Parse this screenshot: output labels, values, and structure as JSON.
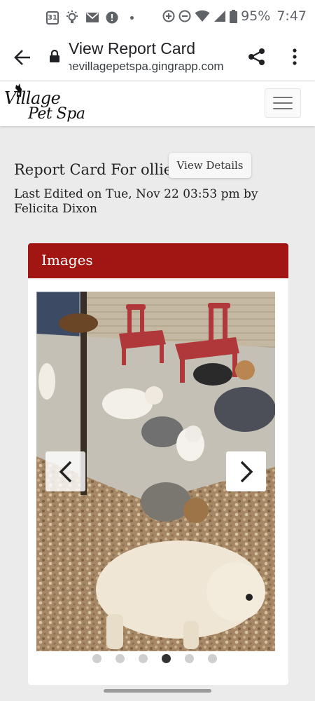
{
  "status_bar": {
    "calendar_day": "31",
    "battery": "95%",
    "time": "7:47",
    "icons": [
      "calendar-icon",
      "lightbulb-icon",
      "mail-icon",
      "alert-icon",
      "dot-icon",
      "data-saver-icon",
      "dnd-icon",
      "wifi-icon",
      "signal-icon",
      "battery-icon"
    ]
  },
  "browser": {
    "title": "View Report Card",
    "url": "thevillagepetspa.gingrapp.com"
  },
  "site": {
    "logo_line1": "Village",
    "logo_line2": "Pet Spa"
  },
  "report": {
    "title": "Report Card For ollie",
    "view_details_label": "View Details",
    "last_edited": "Last Edited on Tue, Nov 22 03:53 pm by Felicita Dixon"
  },
  "images": {
    "header": "Images",
    "slide_count": 6,
    "active_slide": 4
  },
  "colors": {
    "header_red": "#a11512",
    "page_bg": "#ebebeb"
  }
}
